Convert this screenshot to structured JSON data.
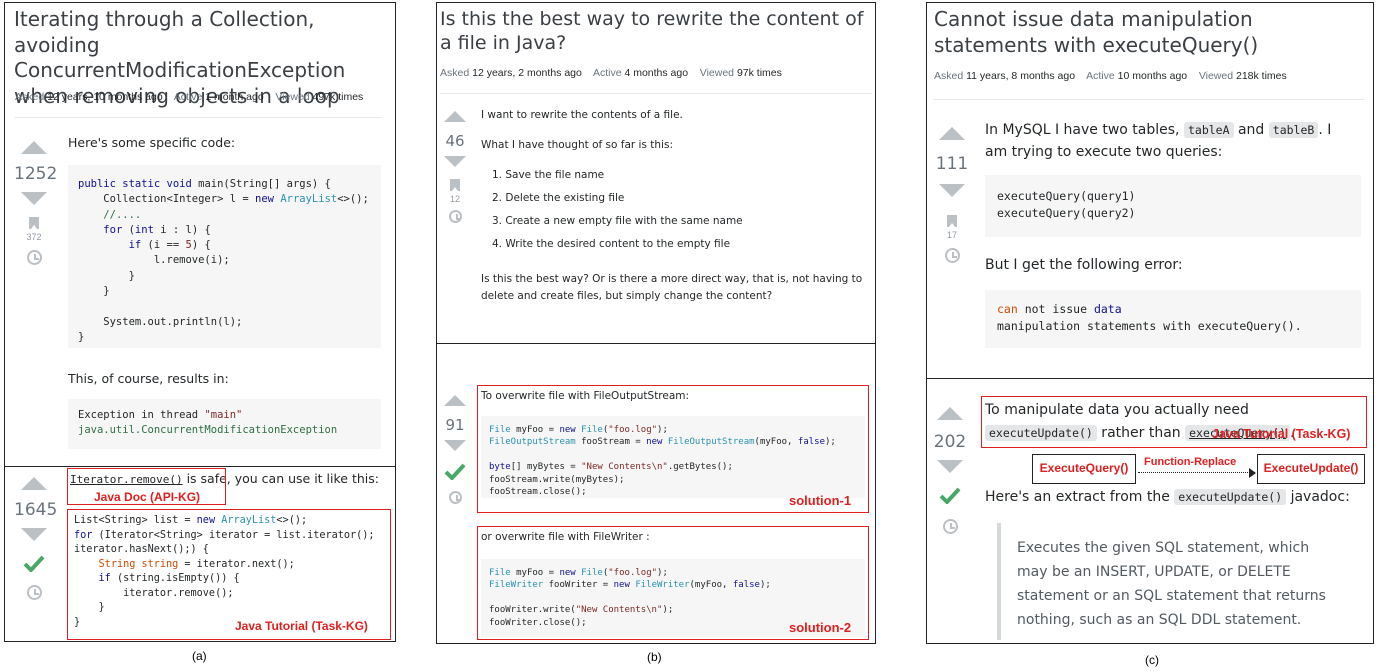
{
  "panel_a": {
    "title": "Iterating through a Collection, avoiding ConcurrentModificationException when removing objects in a loop",
    "meta": {
      "asked_k": "Asked",
      "asked_v": "12 years, 10 months ago",
      "active_k": "Active",
      "active_v": "1 month ago",
      "viewed_k": "Viewed",
      "viewed_v": "497k times"
    },
    "question": {
      "score": "1252",
      "bookmarks": "372",
      "intro": "Here's some specific code:",
      "result_text": "This, of course, results in:"
    },
    "answer": {
      "score": "1645",
      "link_text": "Iterator.remove()",
      "after_link": " is safe, you can use it like this:",
      "label_api": "Java Doc (API-KG)",
      "label_task": "Java Tutorial (Task-KG)"
    },
    "caption": "(a)"
  },
  "panel_b": {
    "title": "Is this the best way to rewrite the content of a file in Java?",
    "meta": {
      "asked_k": "Asked",
      "asked_v": "12 years, 2 months ago",
      "active_k": "Active",
      "active_v": "4 months ago",
      "viewed_k": "Viewed",
      "viewed_v": "97k times"
    },
    "question": {
      "score": "46",
      "bookmarks": "12",
      "p1": "I want to rewrite the contents of a file.",
      "p2": "What I have thought of so far is this:",
      "steps": [
        "1. Save the file name",
        "2. Delete the existing file",
        "3. Create a new empty file with the same name",
        "4. Write the desired content to the empty file"
      ],
      "p3": "Is this the best way? Or is there a more direct way, that is, not having to delete and create files, but simply change the content?"
    },
    "answer": {
      "score": "91",
      "s1_intro": "To overwrite file with FileOutputStream:",
      "s1_label": "solution-1",
      "s2_intro": "or overwrite file with FileWriter :",
      "s2_label": "solution-2"
    },
    "caption": "(b)"
  },
  "panel_c": {
    "title": "Cannot issue data manipulation statements with executeQuery()",
    "meta": {
      "asked_k": "Asked",
      "asked_v": "11 years, 8 months ago",
      "active_k": "Active",
      "active_v": "10 months ago",
      "viewed_k": "Viewed",
      "viewed_v": "218k times"
    },
    "question": {
      "score": "111",
      "bookmarks": "17",
      "p1a": "In MySQL I have two tables, ",
      "codeA": "tableA",
      "p1b": " and ",
      "codeB": "tableB",
      "p1c": ". I am trying to execute two queries:",
      "p2": "But I get the following error:"
    },
    "answer": {
      "score": "202",
      "p1a": "To manipulate data you actually need ",
      "code1": "executeUpdate()",
      "p1b": " rather than ",
      "code2": "executeQuery()",
      "p1c": ".",
      "label_task": "Java Tutorial (Task-KG)",
      "kg_from": "ExecuteQuery()",
      "kg_rel": "Function-Replace",
      "kg_to": "ExecuteUpdate()",
      "p2a": "Here's an extract from the ",
      "code3": "executeUpdate()",
      "p2b": " javadoc:",
      "quote": "Executes the given SQL statement, which may be an INSERT, UPDATE, or DELETE statement or an SQL statement that returns nothing, such as an SQL DDL statement."
    },
    "caption": "(c)"
  },
  "colors": {
    "red": "#e02020",
    "check_green": "#48a868",
    "vote_gray": "#bbc0c4"
  }
}
